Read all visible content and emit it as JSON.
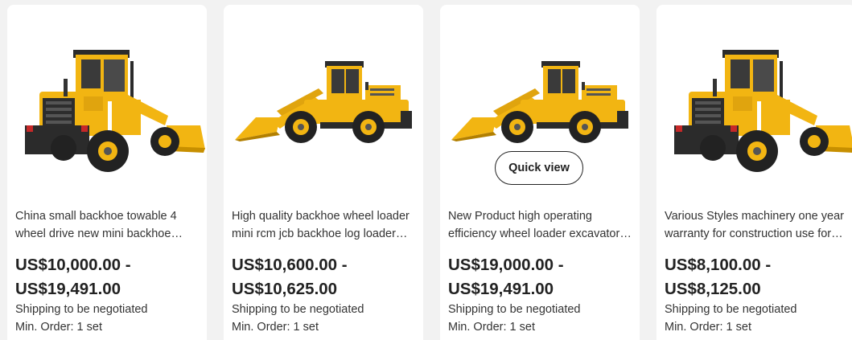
{
  "products": [
    {
      "title": "China small backhoe towable 4 wheel drive new mini backhoe loader",
      "price_min": "US$10,000.00 -",
      "price_max": "US$19,491.00",
      "shipping": "Shipping to be negotiated",
      "min_order": "Min. Order: 1 set",
      "image": "wheel-loader-front-view"
    },
    {
      "title": "High quality backhoe wheel loader mini rcm jcb backhoe log loader price",
      "price_min": "US$10,600.00 -",
      "price_max": "US$10,625.00",
      "shipping": "Shipping to be negotiated",
      "min_order": "Min. Order: 1 set",
      "image": "wheel-loader-side-view"
    },
    {
      "title": "New Product high operating efficiency wheel loader excavator loader",
      "price_min": "US$19,000.00 -",
      "price_max": "US$19,491.00",
      "shipping": "Shipping to be negotiated",
      "min_order": "Min. Order: 1 set",
      "image": "wheel-loader-side-view",
      "quick_view_label": "Quick view"
    },
    {
      "title": "Various Styles machinery one year warranty for construction use for sale",
      "price_min": "US$8,100.00 -",
      "price_max": "US$8,125.00",
      "shipping": "Shipping to be negotiated",
      "min_order": "Min. Order: 1 set",
      "image": "wheel-loader-front-view"
    }
  ],
  "colors": {
    "loader_yellow": "#f2b512",
    "loader_dark": "#2b2b2b",
    "page_bg": "#f2f2f2",
    "card_bg": "#ffffff"
  }
}
